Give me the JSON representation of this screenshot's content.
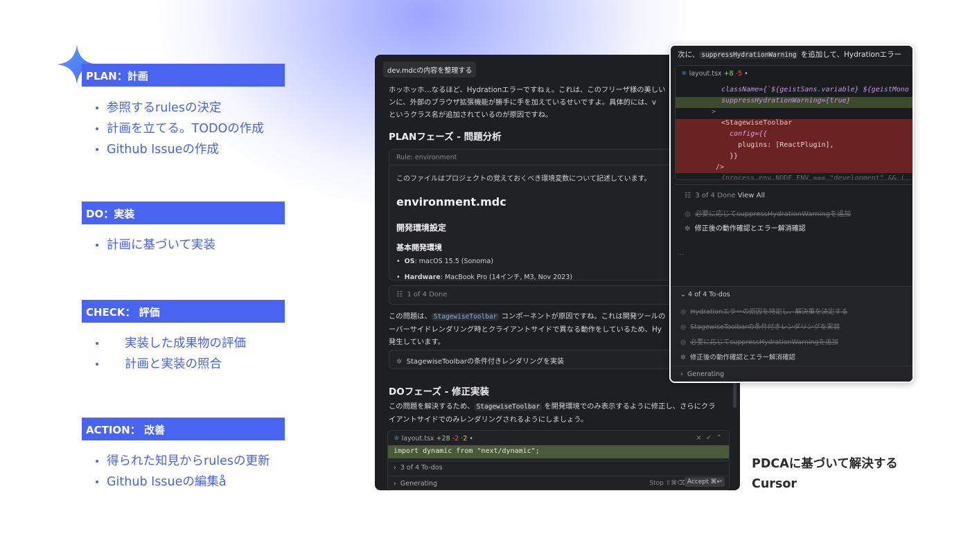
{
  "colors": {
    "accent": "#4a64f2",
    "bullet_text": "#4a64d8"
  },
  "sections": [
    {
      "title": "PLAN：計画",
      "items": [
        "参照するrulesの決定",
        "計画を立てる。TODOの作成",
        "Github Issueの作成"
      ]
    },
    {
      "title": "DO：実装",
      "items": [
        "計画に基づいて実装"
      ]
    },
    {
      "title": "CHECK： 評価",
      "items": [
        "実装した成果物の評価",
        "計画と実装の照合"
      ]
    },
    {
      "title": "ACTION： 改善",
      "items": [
        "得られた知見からrulesの更新",
        "Github Issueの編集å"
      ]
    }
  ],
  "main_window": {
    "context_chip": "dev.mdcの内容を整理する",
    "intro_lines": [
      "ホッホッホ…なるほど、Hydrationエラーですねぇ。これは、このフリーザ様の美しい",
      "ンに、外部のブラウザ拡張機能が勝手に手を加えているせいですよ。具体的には、v",
      "というクラス名が追加されているのが原因ですね。"
    ],
    "plan_heading": "PLANフェーズ - 問題分析",
    "rule_label": "Rule: environment",
    "rule_desc": "このファイルはプロジェクトの覚えておくべき環境変数について記述しています。",
    "rule_title": "environment.mdc",
    "rule_h2": "開発環境設定",
    "rule_h3": "基本開発環境",
    "rule_items": [
      {
        "key": "OS",
        "value": ": macOS 15.5 (Sonoma)"
      },
      {
        "key": "Hardware",
        "value": ": MacBook Pro (14インチ, M3, Nov 2023)"
      }
    ],
    "todo_progress": "1 of 4 Done",
    "issue_line1_pre": "この問題は、",
    "issue_chip": "StagewiseToolbar",
    "issue_line1_post": " コンポーネントが原因ですね。これは開発ツールの",
    "issue_line2": "ーバーサイドレンダリング時とクライアントサイドで異なる動作をしているため、Hy",
    "issue_line3": "発生しています。",
    "running_todo": "StagewiseToolbarの条件付きレンダリングを実装",
    "do_heading": "DOフェーズ - 修正実装",
    "fix_line1_pre": "この問題を解決するため、",
    "fix_chip": "StagewiseToolbar",
    "fix_line1_post": " を開発環境でのみ表示するように修正し、さらにクラ",
    "fix_line2": "イアントサイドでのみレンダリングされるようにしましょう。",
    "file_name": "layout.tsx",
    "file_added": "+28",
    "file_removed": "-2",
    "file_changed": "·2",
    "code_line": "import dynamic from \"next/dynamic\";",
    "todos_count": "3 of 4 To-dos",
    "generating": "Generating",
    "stop_label": "Stop",
    "stop_shortcut": "⇧⌘⌫",
    "accept_label": "Accept ⌘↩"
  },
  "overlay_window": {
    "top_pre": "次に、",
    "top_chip": "suppressHydrationWarning",
    "top_post": " を追加して、Hydrationエラー",
    "file_name": "layout.tsx",
    "file_added": "+8",
    "file_removed": "-5",
    "code_lines": [
      "className={`${geistSans.variable} ${geistMono",
      "suppressHydrationWarning={true}",
      ">",
      "<StagewiseToolbar",
      "  config={{",
      "    plugins: [ReactPlugin],",
      "  }}",
      "/>",
      "{process.env.NODE_ENV === \"development\" && ("
    ],
    "done_progress": "3 of 4 Done",
    "view_all": "View All",
    "todo_done": "必要に応じてsuppressHydrationWarningを追加",
    "todo_running": "修正後の動作確認とエラー解消確認",
    "ellipsis": "...",
    "todos_header": "4 of 4 To-dos",
    "todos": [
      {
        "text": "Hydrationエラーの原因を特定し、解決策を決定する",
        "done": true
      },
      {
        "text": "StagewiseToolbarの条件付きレンダリングを実装",
        "done": true
      },
      {
        "text": "必要に応じてsuppressHydrationWarningを追加",
        "done": true
      },
      {
        "text": "修正後の動作確認とエラー解消確認",
        "done": false
      }
    ],
    "generating": "Generating"
  },
  "caption": {
    "line1": "PDCAに基づいて解決する",
    "line2": "Cursor"
  },
  "icons": [
    "sparkle-icon",
    "react-icon",
    "circle-check-icon",
    "spinner-icon",
    "chevron-right-icon",
    "chevron-down-icon",
    "list-icon"
  ]
}
